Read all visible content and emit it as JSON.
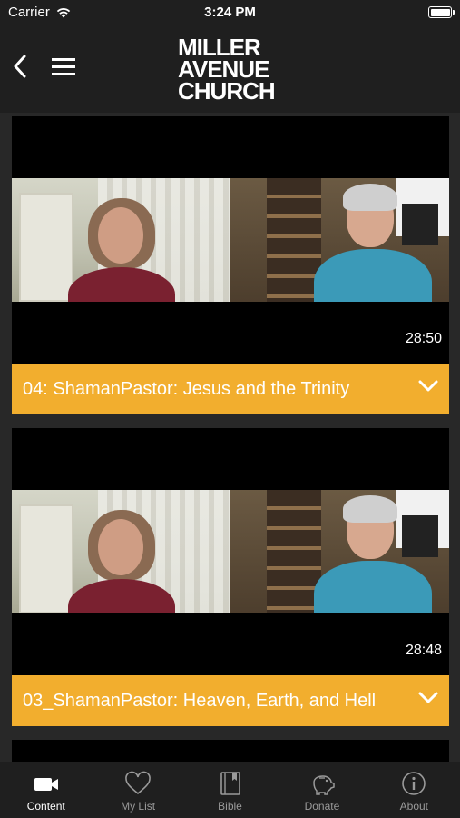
{
  "status": {
    "carrier": "Carrier",
    "time": "3:24 PM"
  },
  "header": {
    "logo_lines": [
      "MILLER",
      "AVENUE",
      "CHURCH"
    ]
  },
  "videos": [
    {
      "duration": "28:50",
      "title": "04: ShamanPastor: Jesus and the Trinity"
    },
    {
      "duration": "28:48",
      "title": "03_ShamanPastor: Heaven, Earth, and Hell"
    }
  ],
  "tabs": [
    {
      "label": "Content",
      "icon": "video-camera-icon",
      "active": true
    },
    {
      "label": "My List",
      "icon": "heart-icon",
      "active": false
    },
    {
      "label": "Bible",
      "icon": "book-icon",
      "active": false
    },
    {
      "label": "Donate",
      "icon": "piggy-bank-icon",
      "active": false
    },
    {
      "label": "About",
      "icon": "info-icon",
      "active": false
    }
  ],
  "colors": {
    "accent": "#f2ae2e",
    "background": "#282828",
    "bar": "#1f1f1f"
  }
}
